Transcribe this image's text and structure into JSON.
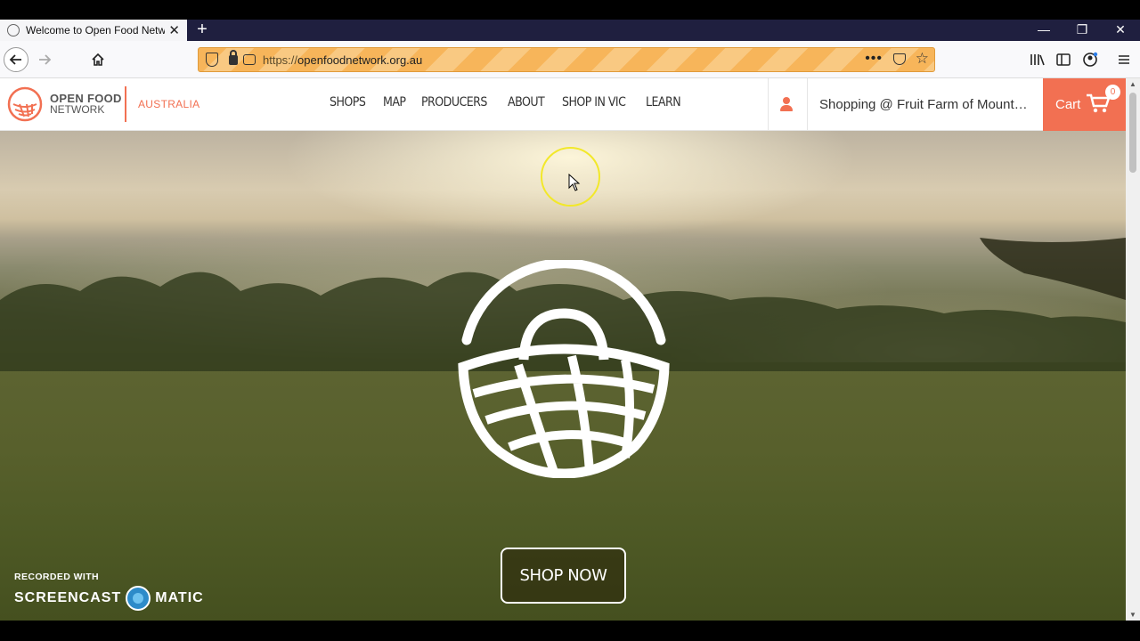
{
  "browser": {
    "tab_title": "Welcome to Open Food Netwo",
    "tab_close": "✕",
    "new_tab": "+",
    "window_controls": {
      "minimize": "—",
      "restore": "❐",
      "close": "✕"
    },
    "url_scheme": "https://",
    "url_host": "openfoodnetwork.org.au",
    "page_actions": "•••",
    "toolbar_icons": [
      "library-icon",
      "sidebar-icon",
      "account-icon",
      "menu-icon"
    ]
  },
  "site": {
    "logo_line1": "OPEN FOOD",
    "logo_line2": "NETWORK",
    "country": "AUSTRALIA",
    "nav": [
      "SHOPS",
      "MAP",
      "PRODUCERS",
      "ABOUT",
      "SHOP IN VIC",
      "LEARN"
    ],
    "shopping_label": "Shopping @ Fruit Farm of Mount…",
    "cart_label": "Cart",
    "cart_count": "0",
    "cta_label": "SHOP NOW",
    "accent_color": "#f27052"
  },
  "watermark": {
    "recorded_with": "RECORDED WITH",
    "brand_left": "SCREENCAST",
    "brand_right": "MATIC"
  }
}
